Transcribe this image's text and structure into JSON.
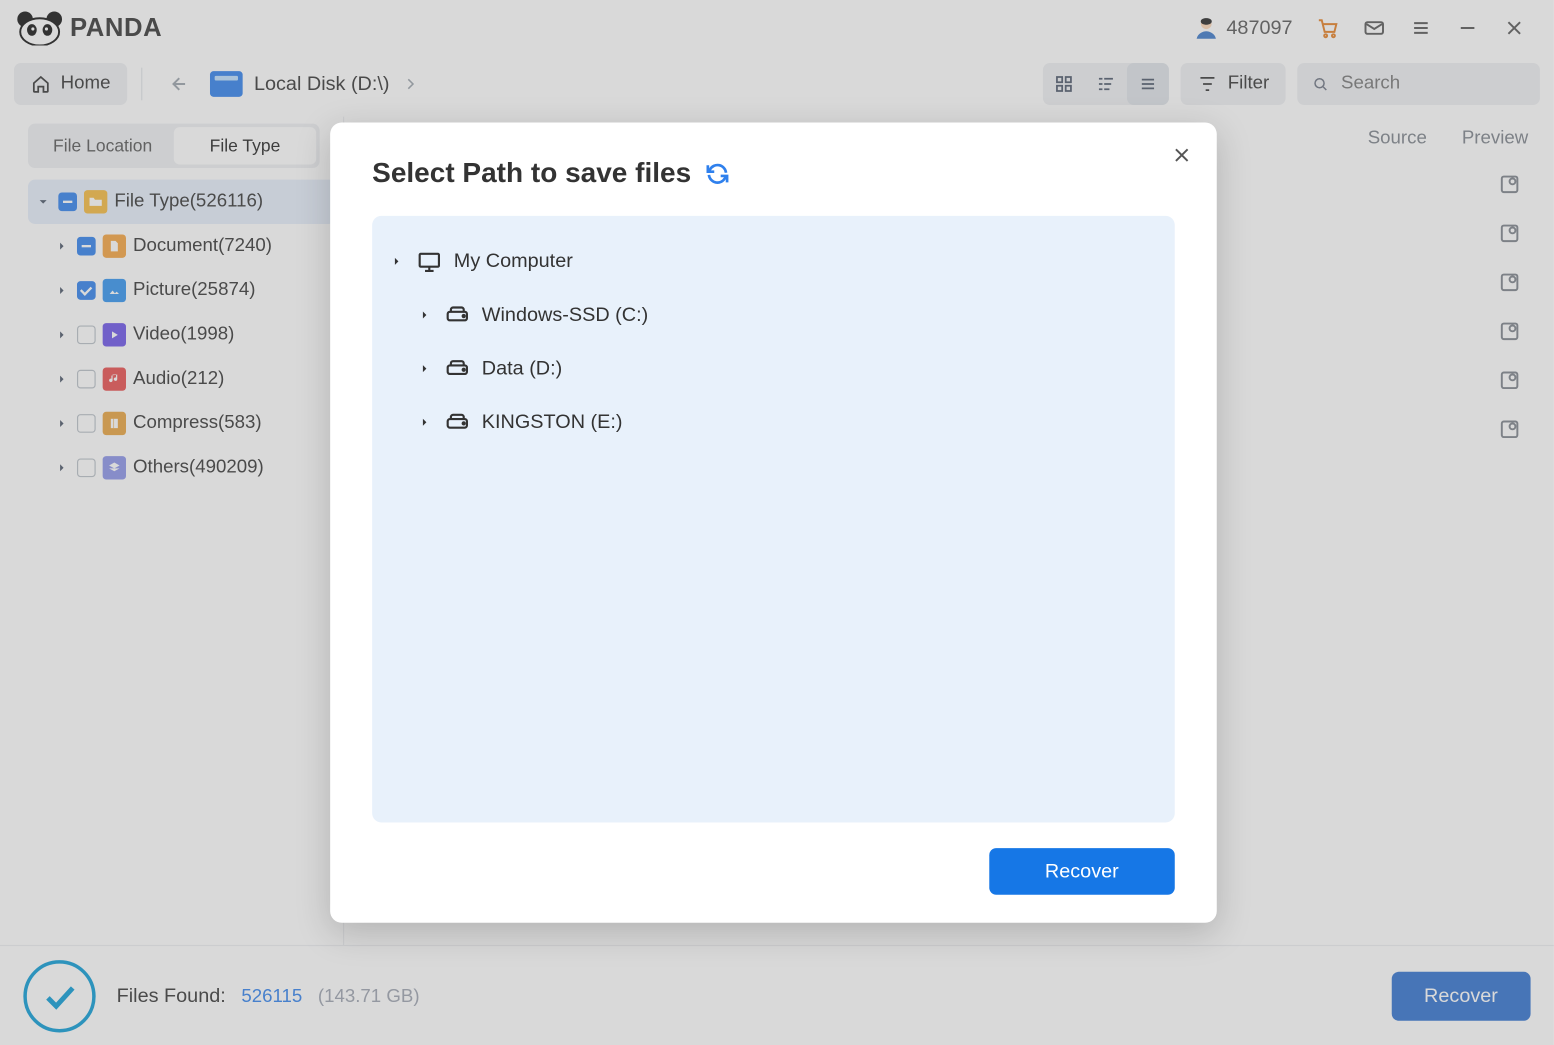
{
  "titlebar": {
    "brand": "PANDA",
    "user_id": "487097"
  },
  "toolbar": {
    "home": "Home",
    "breadcrumb": "Local Disk (D:\\)",
    "filter": "Filter",
    "search_placeholder": "Search"
  },
  "sidebar": {
    "tabs": {
      "location": "File Location",
      "type": "File Type"
    },
    "root": "File Type(526116)",
    "items": [
      {
        "label": "Document(7240)"
      },
      {
        "label": "Picture(25874)"
      },
      {
        "label": "Video(1998)"
      },
      {
        "label": "Audio(212)"
      },
      {
        "label": "Compress(583)"
      },
      {
        "label": "Others(490209)"
      }
    ]
  },
  "right": {
    "source": "Source",
    "preview": "Preview"
  },
  "footer": {
    "label": "Files Found:",
    "count": "526115",
    "size": "(143.71 GB)",
    "recover": "Recover"
  },
  "modal": {
    "title": "Select Path to save files",
    "root": "My Computer",
    "drives": [
      {
        "label": "Windows-SSD (C:)"
      },
      {
        "label": "Data (D:)"
      },
      {
        "label": "KINGSTON (E:)"
      }
    ],
    "recover": "Recover"
  }
}
